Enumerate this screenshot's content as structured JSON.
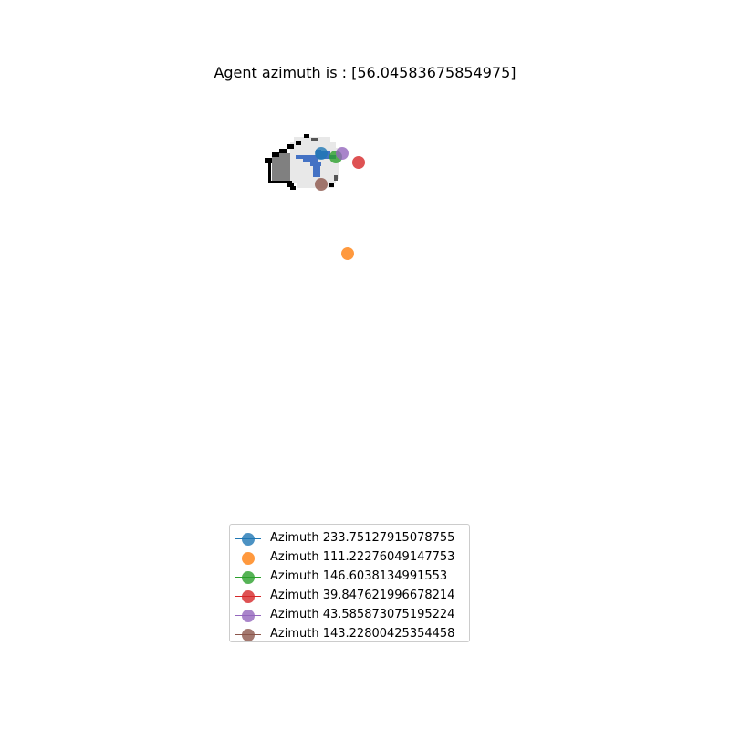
{
  "chart_data": {
    "type": "scatter",
    "title": "Agent azimuth is : [56.04583675854975]",
    "axes_visible": false,
    "grid": false,
    "legend_position": "lower-center",
    "series": [
      {
        "name": "Azimuth 233.75127915078755",
        "color": "#1f77b4"
      },
      {
        "name": "Azimuth 111.22276049147753",
        "color": "#ff7f0e"
      },
      {
        "name": "Azimuth 146.6038134991553",
        "color": "#2ca02c"
      },
      {
        "name": "Azimuth 39.847621996678214",
        "color": "#d62728"
      },
      {
        "name": "Azimuth 43.585873075195224",
        "color": "#9467bd"
      },
      {
        "name": "Azimuth 143.22800425354458",
        "color": "#8c564b"
      }
    ]
  }
}
